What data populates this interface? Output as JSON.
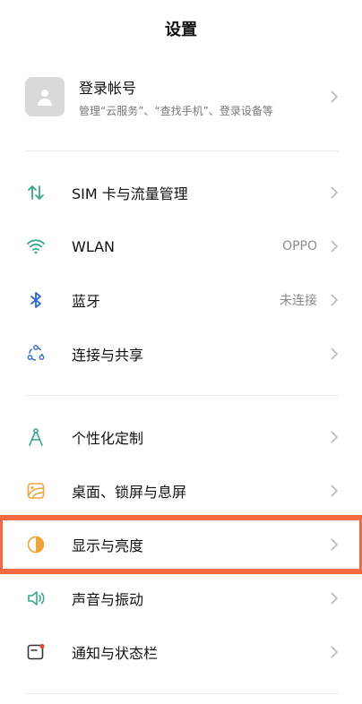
{
  "header": {
    "title": "设置"
  },
  "account": {
    "title": "登录帐号",
    "subtitle": "管理“云服务”、“查找手机”、登录设备等"
  },
  "group1": [
    {
      "label": "SIM 卡与流量管理",
      "value": ""
    },
    {
      "label": "WLAN",
      "value": "OPPO"
    },
    {
      "label": "蓝牙",
      "value": "未连接"
    },
    {
      "label": "连接与共享",
      "value": ""
    }
  ],
  "group2": [
    {
      "label": "个性化定制"
    },
    {
      "label": "桌面、锁屏与息屏"
    },
    {
      "label": "显示与亮度"
    },
    {
      "label": "声音与振动"
    },
    {
      "label": "通知与状态栏"
    }
  ],
  "colors": {
    "accent_green": "#34a88f",
    "highlight": "#f06a43",
    "bt_blue": "#2f68c8",
    "orange": "#f0a23b"
  }
}
